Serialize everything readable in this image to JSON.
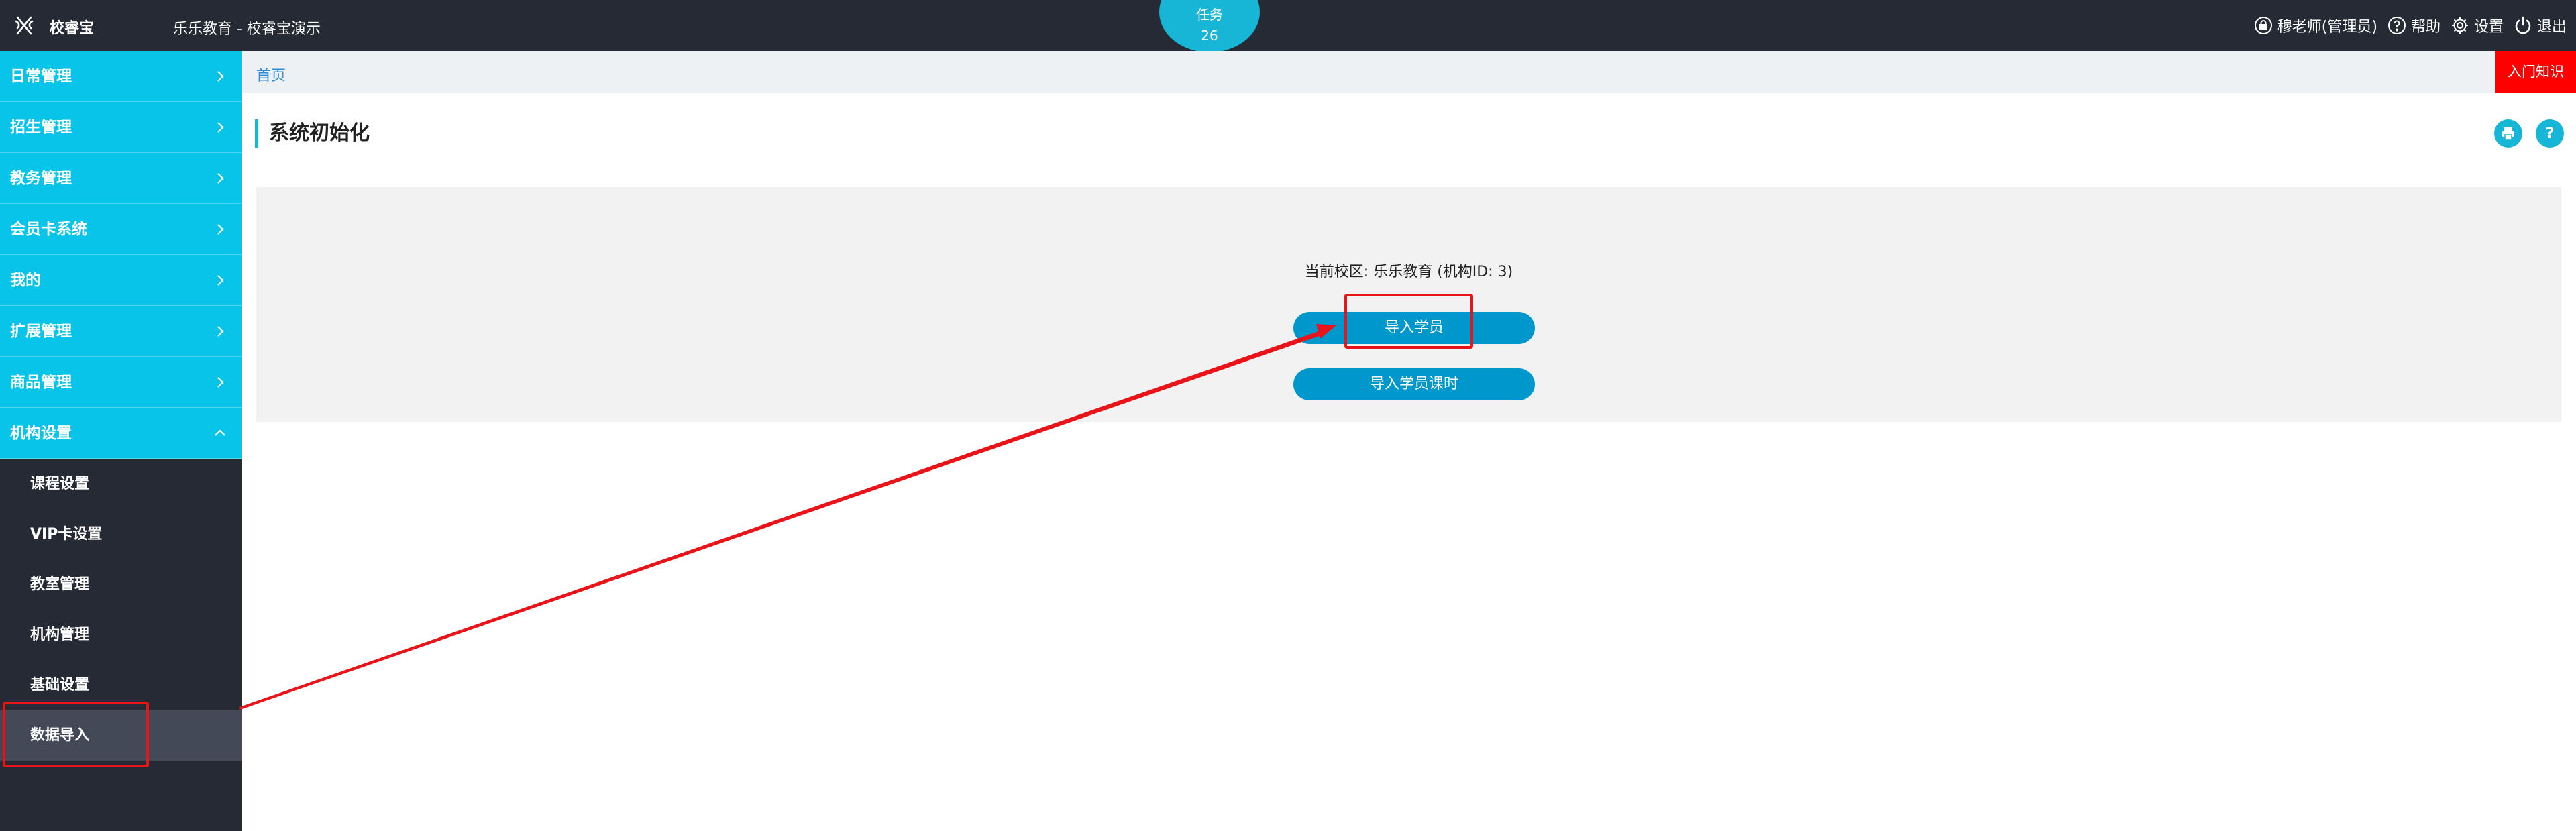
{
  "header": {
    "brand": "校睿宝",
    "title": "乐乐教育 - 校睿宝演示",
    "task": {
      "label": "任务",
      "count": "26"
    },
    "user": "穆老师(管理员)",
    "help": "帮助",
    "settings": "设置",
    "logout": "退出"
  },
  "sidebar": {
    "menus": [
      {
        "label": "日常管理"
      },
      {
        "label": "招生管理"
      },
      {
        "label": "教务管理"
      },
      {
        "label": "会员卡系统"
      },
      {
        "label": "我的"
      },
      {
        "label": "扩展管理"
      },
      {
        "label": "商品管理"
      },
      {
        "label": "机构设置"
      }
    ],
    "submenu": [
      {
        "label": "课程设置"
      },
      {
        "label": "VIP卡设置"
      },
      {
        "label": "教室管理"
      },
      {
        "label": "机构管理"
      },
      {
        "label": "基础设置"
      },
      {
        "label": "数据导入"
      }
    ]
  },
  "breadcrumb": "首页",
  "intro_button": "入门知识",
  "page_title": "系统初始化",
  "help_button": "?",
  "main": {
    "campus": "当前校区: 乐乐教育 (机构ID: 3)",
    "import_students": "导入学员",
    "import_hours": "导入学员课时"
  },
  "colors": {
    "topbar": "#252a35",
    "accent": "#07c4e8",
    "button": "#0098cc",
    "annotation": "#e8141a",
    "intro": "#ff0000"
  }
}
